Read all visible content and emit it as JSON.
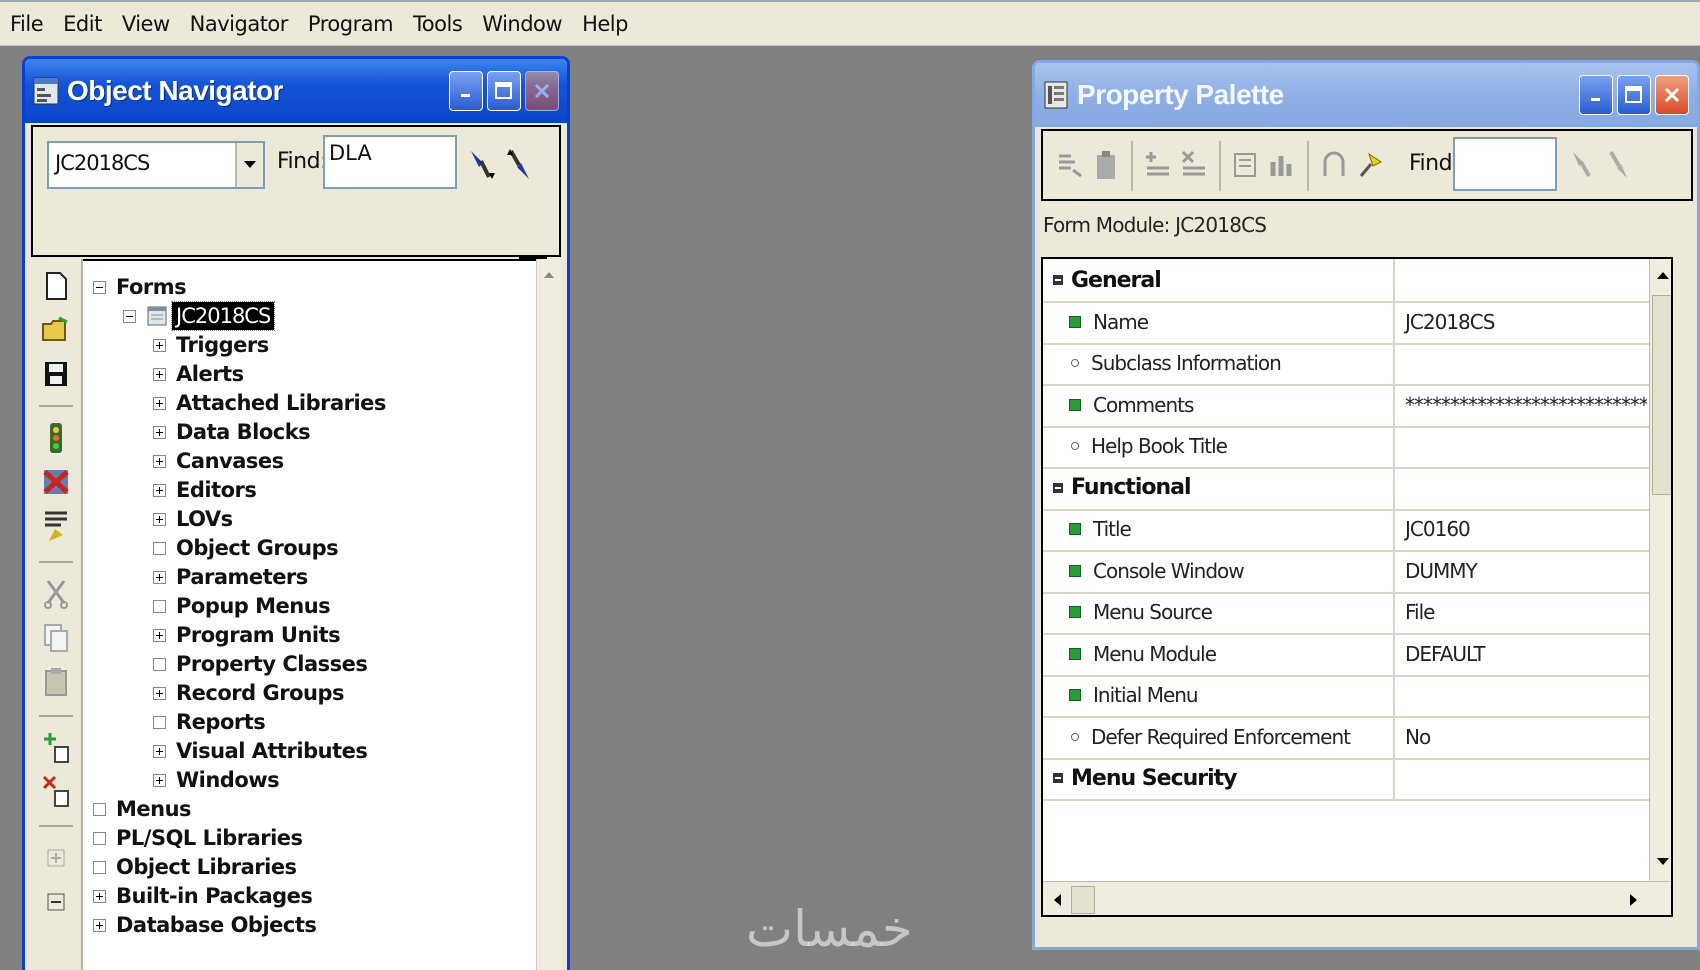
{
  "menu": [
    "File",
    "Edit",
    "View",
    "Navigator",
    "Program",
    "Tools",
    "Window",
    "Help"
  ],
  "navigator": {
    "title": "Object Navigator",
    "module_combo": "JC2018CS",
    "find_label": "Find:",
    "find_value": "DLA",
    "tree": [
      {
        "label": "Forms",
        "level": 0,
        "exp": "minus"
      },
      {
        "label": "JC2018CS",
        "level": 1,
        "exp": "minus",
        "selected": true
      },
      {
        "label": "Triggers",
        "level": 2,
        "exp": "plus"
      },
      {
        "label": "Alerts",
        "level": 2,
        "exp": "plus"
      },
      {
        "label": "Attached Libraries",
        "level": 2,
        "exp": "plus"
      },
      {
        "label": "Data Blocks",
        "level": 2,
        "exp": "plus"
      },
      {
        "label": "Canvases",
        "level": 2,
        "exp": "plus"
      },
      {
        "label": "Editors",
        "level": 2,
        "exp": "plus"
      },
      {
        "label": "LOVs",
        "level": 2,
        "exp": "plus"
      },
      {
        "label": "Object Groups",
        "level": 2,
        "exp": "empty"
      },
      {
        "label": "Parameters",
        "level": 2,
        "exp": "plus"
      },
      {
        "label": "Popup Menus",
        "level": 2,
        "exp": "empty"
      },
      {
        "label": "Program Units",
        "level": 2,
        "exp": "plus"
      },
      {
        "label": "Property Classes",
        "level": 2,
        "exp": "empty"
      },
      {
        "label": "Record Groups",
        "level": 2,
        "exp": "plus"
      },
      {
        "label": "Reports",
        "level": 2,
        "exp": "empty"
      },
      {
        "label": "Visual Attributes",
        "level": 2,
        "exp": "plus"
      },
      {
        "label": "Windows",
        "level": 2,
        "exp": "plus"
      },
      {
        "label": "Menus",
        "level": 0,
        "exp": "empty"
      },
      {
        "label": "PL/SQL Libraries",
        "level": 0,
        "exp": "empty"
      },
      {
        "label": "Object Libraries",
        "level": 0,
        "exp": "empty"
      },
      {
        "label": "Built-in Packages",
        "level": 0,
        "exp": "plus"
      },
      {
        "label": "Database Objects",
        "level": 0,
        "exp": "plus"
      }
    ]
  },
  "palette": {
    "title": "Property Palette",
    "find_label": "Find:",
    "find_value": "",
    "caption": "Form Module: JC2018CS",
    "rows": [
      {
        "type": "category",
        "name": "General",
        "value": ""
      },
      {
        "type": "prop",
        "bullet": "green",
        "name": "Name",
        "value": "JC2018CS"
      },
      {
        "type": "prop",
        "bullet": "dot",
        "name": "Subclass Information",
        "value": ""
      },
      {
        "type": "prop",
        "bullet": "green",
        "name": "Comments",
        "value": "******************************"
      },
      {
        "type": "prop",
        "bullet": "dot",
        "name": "Help Book Title",
        "value": ""
      },
      {
        "type": "category",
        "name": "Functional",
        "value": ""
      },
      {
        "type": "prop",
        "bullet": "green",
        "name": "Title",
        "value": "JC0160"
      },
      {
        "type": "prop",
        "bullet": "green",
        "name": "Console Window",
        "value": "DUMMY"
      },
      {
        "type": "prop",
        "bullet": "green",
        "name": "Menu Source",
        "value": "File"
      },
      {
        "type": "prop",
        "bullet": "green",
        "name": "Menu Module",
        "value": "DEFAULT"
      },
      {
        "type": "prop",
        "bullet": "green",
        "name": "Initial Menu",
        "value": ""
      },
      {
        "type": "prop",
        "bullet": "dot",
        "name": "Defer Required Enforcement",
        "value": "No"
      },
      {
        "type": "category",
        "name": "Menu Security",
        "value": ""
      }
    ]
  },
  "watermark": "خمسات"
}
